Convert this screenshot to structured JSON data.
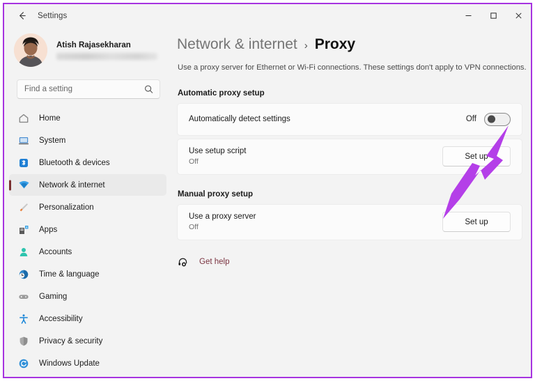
{
  "window": {
    "title": "Settings",
    "back_icon": "back-arrow-icon",
    "controls": {
      "minimize": "minimize-icon",
      "maximize": "maximize-icon",
      "close": "close-icon"
    },
    "frame_color": "#a633e0"
  },
  "account": {
    "name": "Atish Rajasekharan",
    "email_redacted": true
  },
  "search": {
    "placeholder": "Find a setting",
    "value": "",
    "icon": "search-icon"
  },
  "sidebar": {
    "items": [
      {
        "label": "Home",
        "icon": "home-icon",
        "selected": false
      },
      {
        "label": "System",
        "icon": "system-icon",
        "selected": false
      },
      {
        "label": "Bluetooth & devices",
        "icon": "bluetooth-icon",
        "selected": false
      },
      {
        "label": "Network & internet",
        "icon": "wifi-icon",
        "selected": true
      },
      {
        "label": "Personalization",
        "icon": "paintbrush-icon",
        "selected": false
      },
      {
        "label": "Apps",
        "icon": "apps-icon",
        "selected": false
      },
      {
        "label": "Accounts",
        "icon": "account-icon",
        "selected": false
      },
      {
        "label": "Time & language",
        "icon": "clock-globe-icon",
        "selected": false
      },
      {
        "label": "Gaming",
        "icon": "gamepad-icon",
        "selected": false
      },
      {
        "label": "Accessibility",
        "icon": "accessibility-icon",
        "selected": false
      },
      {
        "label": "Privacy & security",
        "icon": "shield-icon",
        "selected": false
      },
      {
        "label": "Windows Update",
        "icon": "update-icon",
        "selected": false
      }
    ],
    "accent_color": "#7a3030"
  },
  "main": {
    "breadcrumb": {
      "parent": "Network & internet",
      "separator": "›",
      "current": "Proxy"
    },
    "description": "Use a proxy server for Ethernet or Wi-Fi connections. These settings don't apply to VPN connections.",
    "sections": [
      {
        "heading": "Automatic proxy setup",
        "rows": [
          {
            "title": "Automatically detect settings",
            "control": "toggle",
            "state_label": "Off",
            "toggle_on": false
          },
          {
            "title": "Use setup script",
            "subtitle": "Off",
            "control": "button",
            "button_label": "Set up"
          }
        ]
      },
      {
        "heading": "Manual proxy setup",
        "rows": [
          {
            "title": "Use a proxy server",
            "subtitle": "Off",
            "control": "button",
            "button_label": "Set up"
          }
        ]
      }
    ],
    "get_help": {
      "label": "Get help",
      "icon": "help-headset-icon",
      "color": "#7a3340"
    }
  },
  "annotation": {
    "arrow": {
      "icon": "arrow-pointer-annotation",
      "color": "#b43fe8",
      "points_to": "Automatically detect settings toggle"
    }
  }
}
